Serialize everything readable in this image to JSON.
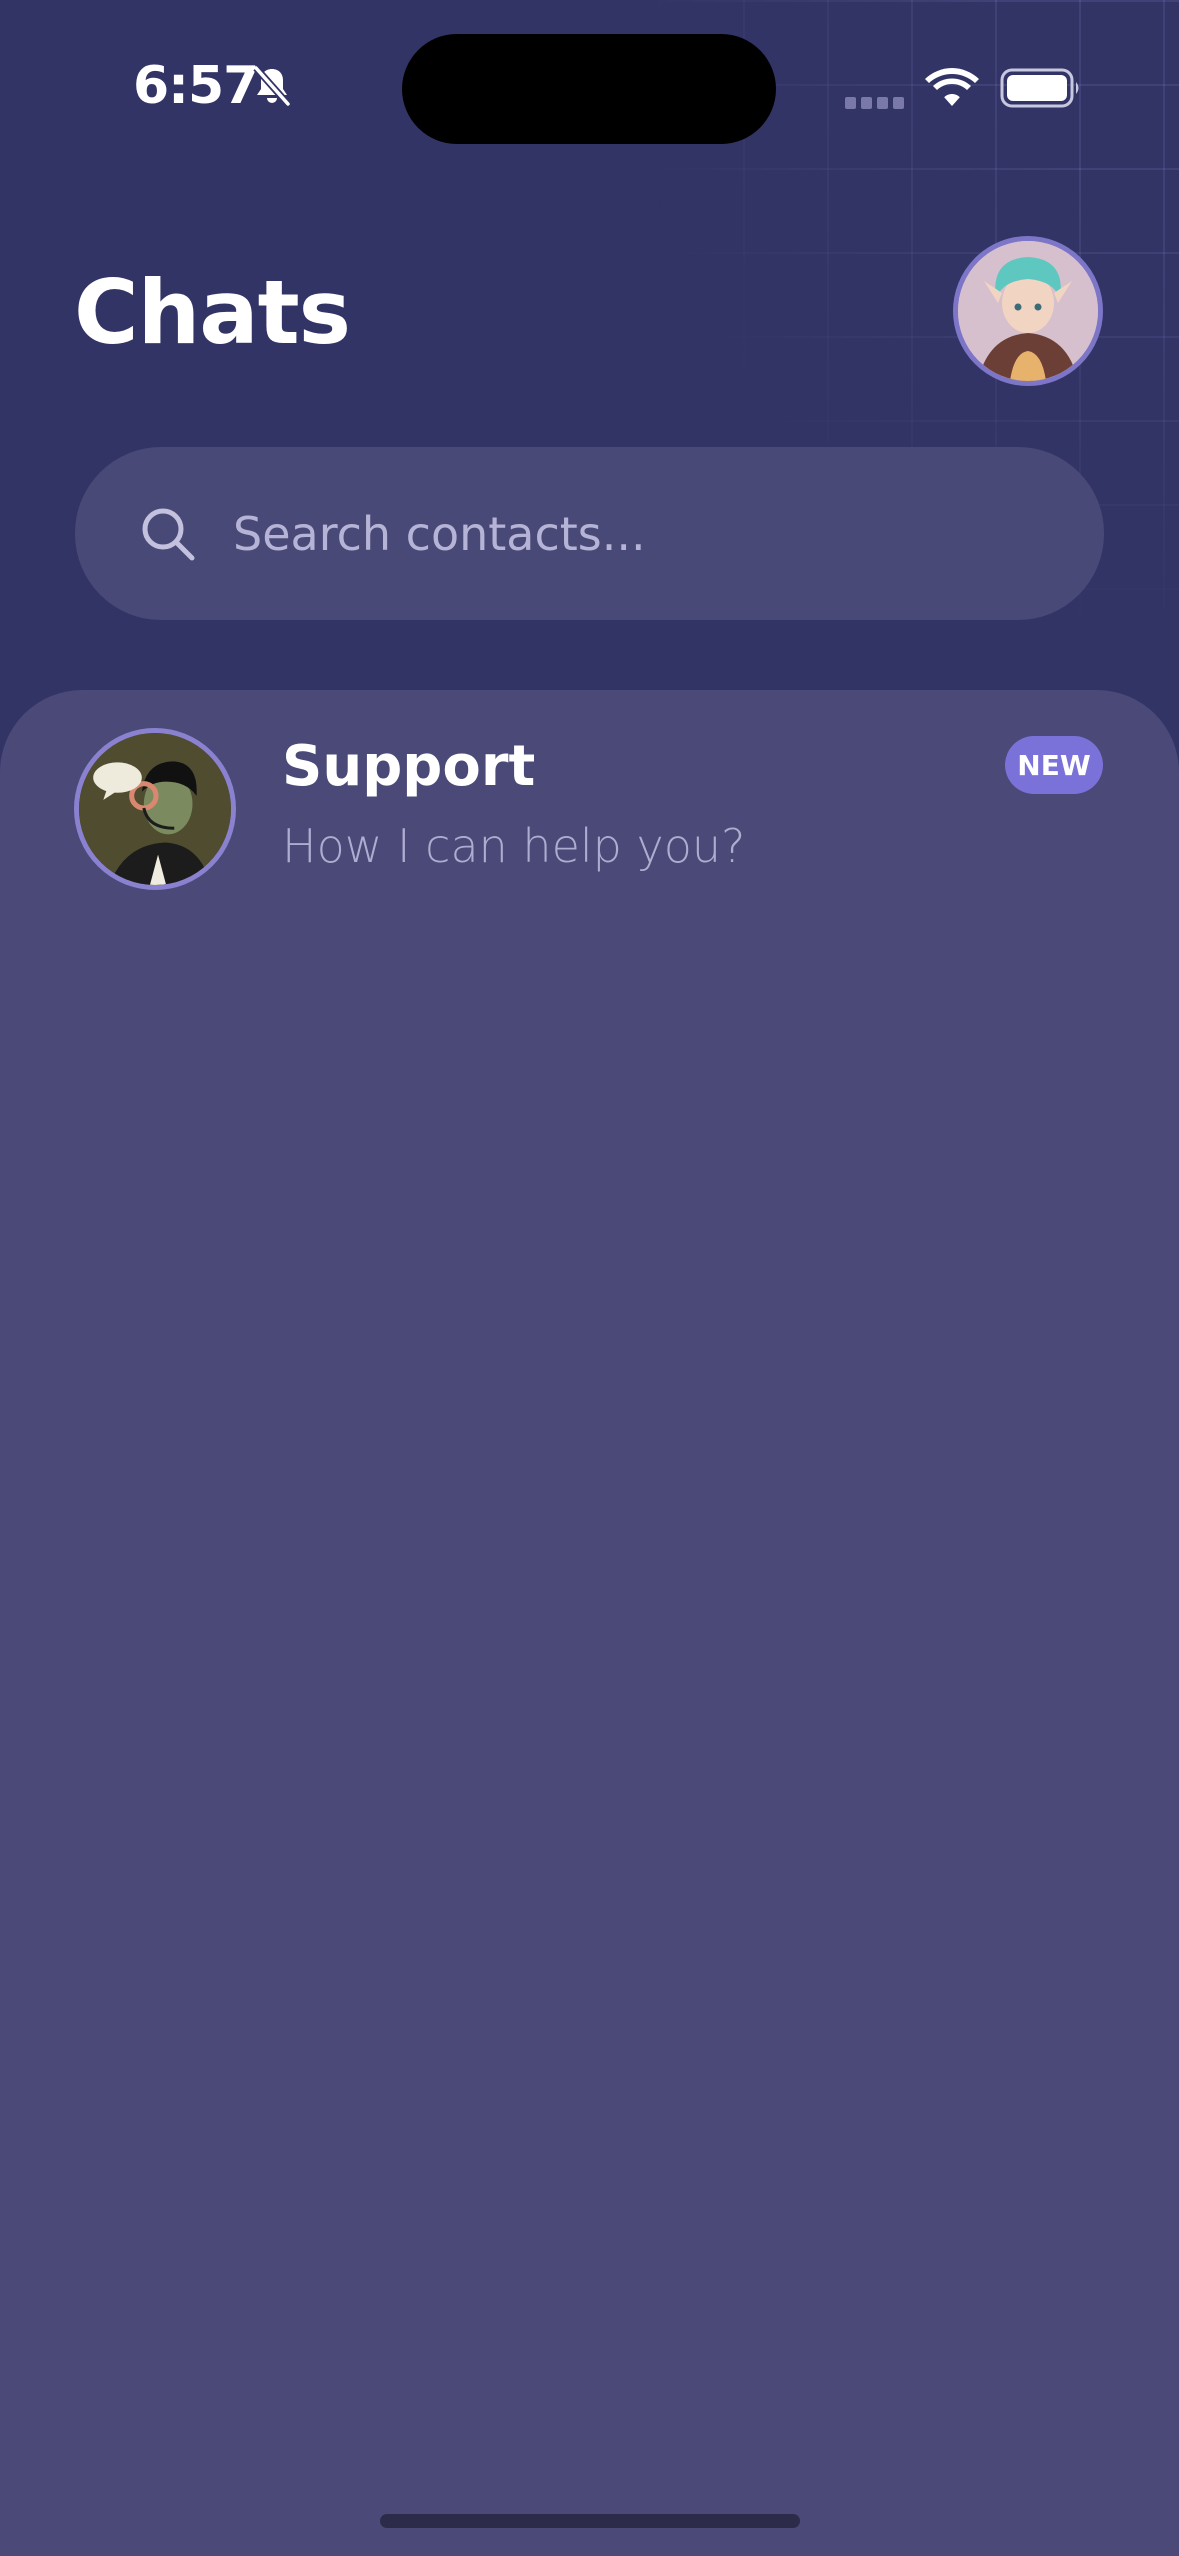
{
  "status_bar": {
    "time": "6:57",
    "icons": [
      "bell-slash-icon",
      "signal-icon",
      "wifi-icon",
      "battery-icon"
    ]
  },
  "header": {
    "title": "Chats",
    "profile_avatar": "elf-avatar-icon"
  },
  "search": {
    "placeholder": "Search contacts...",
    "value": "",
    "icon": "search-icon"
  },
  "chats": [
    {
      "name": "Support",
      "preview": "How I can help you?",
      "badge": "NEW",
      "avatar": "support-agent-avatar-icon"
    }
  ],
  "colors": {
    "background": "#333466",
    "panel": "#4a4977",
    "search_bg": "#494978",
    "badge": "#7b72d9",
    "preview_text": "#aeacd0"
  }
}
